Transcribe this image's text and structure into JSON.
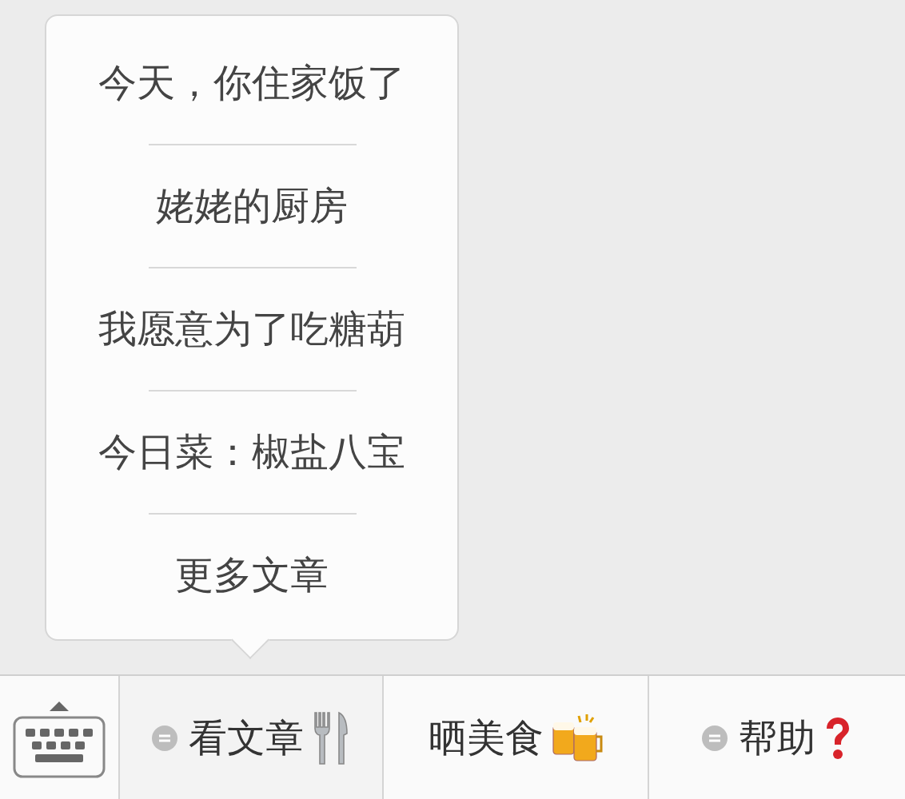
{
  "menu_bar": {
    "items": [
      {
        "label": "看文章",
        "has_submenu": true,
        "expanded": true,
        "submenu": [
          "今天，你住家饭了",
          "姥姥的厨房",
          "我愿意为了吃糖葫",
          "今日菜：椒盐八宝",
          "更多文章"
        ]
      },
      {
        "label": "晒美食",
        "has_submenu": false,
        "expanded": false
      },
      {
        "label": "帮助",
        "has_submenu": true,
        "expanded": false
      }
    ]
  }
}
